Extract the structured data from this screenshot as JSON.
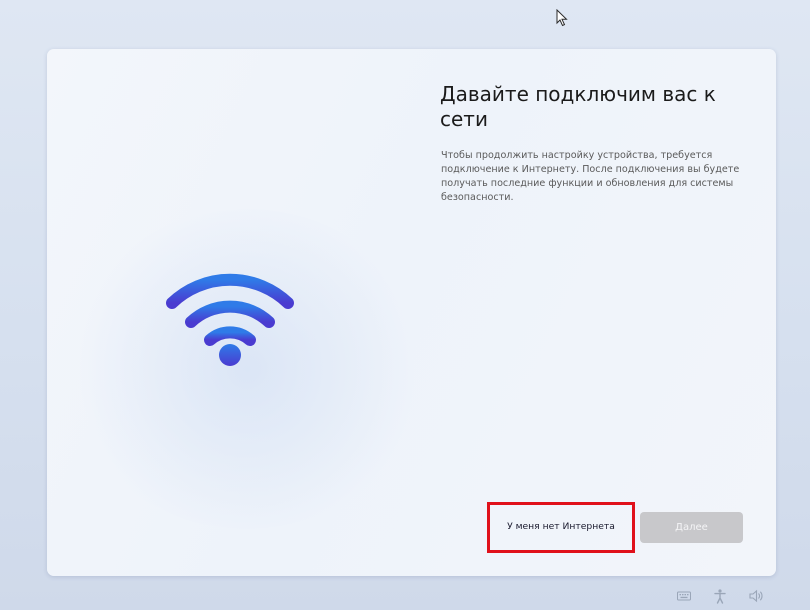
{
  "setup": {
    "title": "Давайте подключим вас к сети",
    "description": "Чтобы продолжить настройку устройства, требуется подключение к Интернету. После подключения вы будете получать последние функции и обновления для системы безопасности.",
    "no_internet_label": "У меня нет Интернета",
    "next_label": "Далее",
    "next_enabled": false,
    "illustration_icon": "wifi-icon"
  },
  "annotation": {
    "highlight_color": "#e0101a",
    "target": "no-internet-button"
  },
  "tray": {
    "icons": [
      "keyboard-icon",
      "accessibility-icon",
      "volume-icon"
    ]
  },
  "colors": {
    "wifi_gradient_top": "#2f7be8",
    "wifi_gradient_bottom": "#4a3bd0",
    "disabled_button": "#c8c8cb"
  }
}
